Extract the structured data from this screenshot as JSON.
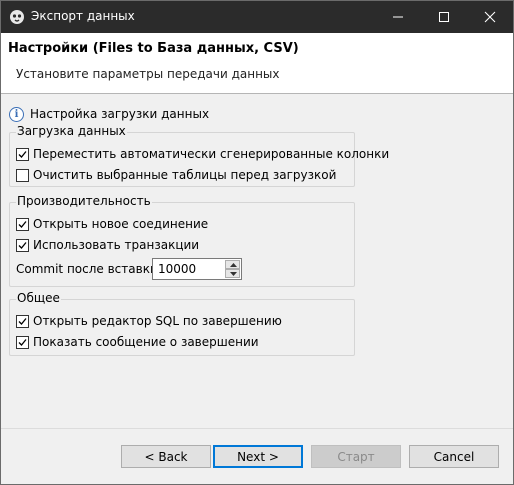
{
  "window": {
    "title": "Экспорт данных"
  },
  "header": {
    "title": "Настройки (Files to База данных, CSV)",
    "description": "Установите параметры передачи данных"
  },
  "info": {
    "label": "Настройка загрузки данных"
  },
  "groups": {
    "load": {
      "title": "Загрузка данных",
      "items": [
        {
          "label": "Переместить автоматически сгенерированные колонки",
          "checked": true
        },
        {
          "label": "Очистить выбранные таблицы перед загрузкой",
          "checked": false
        }
      ]
    },
    "performance": {
      "title": "Производительность",
      "items": [
        {
          "label": "Открыть новое соединение",
          "checked": true
        },
        {
          "label": "Использовать транзакции",
          "checked": true
        }
      ],
      "commit_label": "Commit после вставки:",
      "commit_value": "10000"
    },
    "general": {
      "title": "Общее",
      "items": [
        {
          "label": "Открыть редактор SQL по завершению",
          "checked": true
        },
        {
          "label": "Показать сообщение о завершении",
          "checked": true
        }
      ]
    }
  },
  "buttons": {
    "back": "< Back",
    "next": "Next >",
    "start": "Старт",
    "cancel": "Cancel",
    "start_enabled": false
  },
  "icons": {
    "app": "dbeaver-beaver-icon",
    "info": "info-icon",
    "minimize": "minimize-icon",
    "maximize": "maximize-icon",
    "close": "close-icon"
  },
  "colors": {
    "titlebar": "#2b2b2b",
    "default_button_border": "#0078d7",
    "info_icon": "#3b6fb6"
  }
}
